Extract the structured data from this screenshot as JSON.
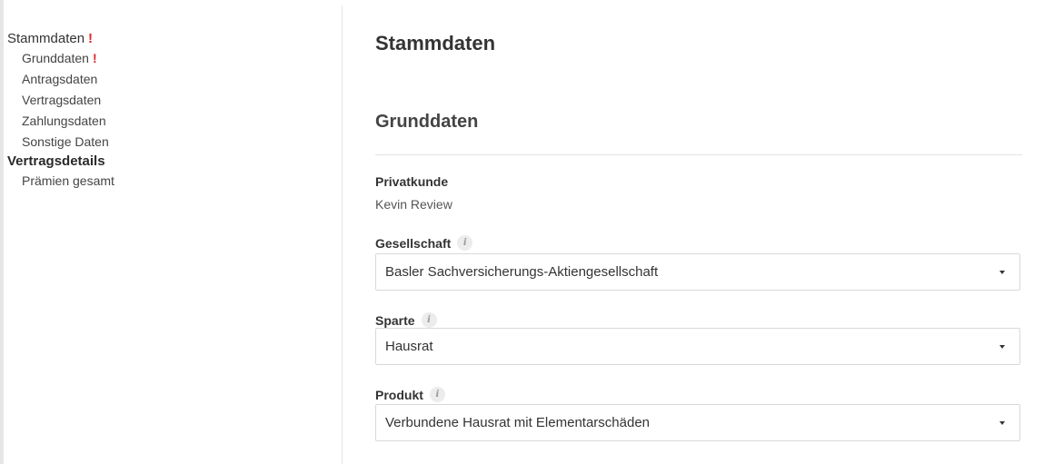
{
  "sidebar": {
    "sections": [
      {
        "label": "Stammdaten",
        "warning": "!",
        "items": [
          {
            "label": "Grunddaten",
            "warning": "!"
          },
          {
            "label": "Antragsdaten"
          },
          {
            "label": "Vertragsdaten"
          },
          {
            "label": "Zahlungsdaten"
          },
          {
            "label": "Sonstige Daten"
          }
        ]
      },
      {
        "label": "Vertragsdetails",
        "items": [
          {
            "label": "Prämien gesamt"
          }
        ]
      }
    ]
  },
  "main": {
    "title": "Stammdaten",
    "section_title": "Grunddaten",
    "customer": {
      "label": "Privatkunde",
      "value": "Kevin Review"
    },
    "fields": {
      "gesellschaft": {
        "label": "Gesellschaft",
        "info_icon": "i",
        "value": "Basler Sachversicherungs-Aktiengesellschaft"
      },
      "sparte": {
        "label": "Sparte",
        "info_icon": "i",
        "value": "Hausrat"
      },
      "produkt": {
        "label": "Produkt",
        "info_icon": "i",
        "value": "Verbundene Hausrat mit Elementarschäden"
      }
    }
  },
  "colors": {
    "warning": "#e4222b",
    "border": "#d9d9d9",
    "text": "#333333"
  }
}
